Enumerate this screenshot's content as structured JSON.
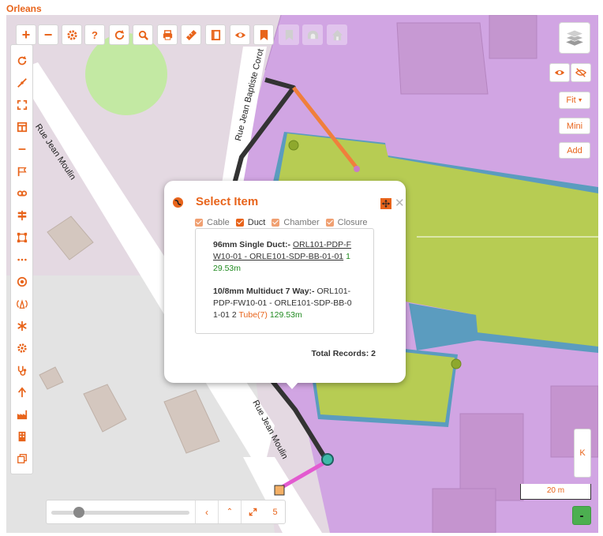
{
  "app": {
    "title": "Orleans"
  },
  "map": {
    "streets": [
      "Rue Jean Moulin",
      "Rue Jean Baptiste Corot",
      "Rue Jean Moulin"
    ],
    "colors": {
      "parcel": "#d1a5e3",
      "green_area": "#b7cc53",
      "blue_area": "#5b9cbf",
      "duct_orange": "#f07f3c",
      "cable_dark": "#333333",
      "pink_link": "#e35ad0"
    }
  },
  "toolbar": {
    "items": [
      {
        "label": "+",
        "icon": "zoom-in-icon"
      },
      {
        "label": "−",
        "icon": "zoom-out-icon"
      },
      {
        "label": "",
        "icon": "gear-icon"
      },
      {
        "label": "?",
        "icon": "help-icon"
      },
      {
        "label": "",
        "icon": "refresh-icon"
      },
      {
        "label": "",
        "icon": "search-icon"
      },
      {
        "label": "",
        "icon": "print-icon"
      },
      {
        "label": "",
        "icon": "ruler-icon"
      },
      {
        "label": "",
        "icon": "book-icon"
      },
      {
        "label": "",
        "icon": "eye-icon"
      },
      {
        "label": "",
        "icon": "bookmark-icon"
      },
      {
        "label": "",
        "icon": "bookmark-icon"
      },
      {
        "label": "",
        "icon": "tunnel-icon"
      },
      {
        "label": "",
        "icon": "home-icon"
      }
    ]
  },
  "left_toolbar": {
    "items": [
      {
        "icon": "redo-icon"
      },
      {
        "icon": "line-tool-icon"
      },
      {
        "icon": "fullscreen-icon"
      },
      {
        "icon": "layout-icon"
      },
      {
        "icon": "minus-icon"
      },
      {
        "icon": "flag-icon"
      },
      {
        "icon": "link-icon"
      },
      {
        "icon": "signpost-icon"
      },
      {
        "icon": "polygon-icon"
      },
      {
        "icon": "dots-icon"
      },
      {
        "icon": "target-icon"
      },
      {
        "icon": "antenna-icon"
      },
      {
        "icon": "asterisk-icon"
      },
      {
        "icon": "cog-icon"
      },
      {
        "icon": "stethoscope-icon"
      },
      {
        "icon": "arrow-up-icon"
      },
      {
        "icon": "factory-icon"
      },
      {
        "icon": "building-icon"
      },
      {
        "icon": "copy-icon"
      }
    ]
  },
  "right_controls": {
    "fit": "Fit",
    "mini": "Mini",
    "add": "Add",
    "k": "K",
    "minus": "-"
  },
  "popup": {
    "title": "Select Item",
    "filters": [
      {
        "label": "Cable",
        "checked": false
      },
      {
        "label": "Duct",
        "checked": true
      },
      {
        "label": "Chamber",
        "checked": false
      },
      {
        "label": "Closure",
        "checked": false
      }
    ],
    "results": [
      {
        "name": "96mm Single Duct:-",
        "ref_part1": "ORL101-PDP-F",
        "ref_part2": "W10-01 - ORLE101-SDP-BB-01-01",
        "count": "1",
        "length": "29.53m"
      },
      {
        "name": "10/8mm Multiduct 7 Way:-",
        "ref_part1": "ORL101-",
        "ref_part2": "PDP-FW10-01 - ORLE101-SDP-BB-0",
        "ref_part3": "1-01 2",
        "tube": "Tube(7)",
        "length": "129.53m"
      }
    ],
    "total": "Total Records: 2"
  },
  "timeline": {
    "value": 0.2,
    "count": "5"
  },
  "scale": {
    "label": "20 m"
  }
}
